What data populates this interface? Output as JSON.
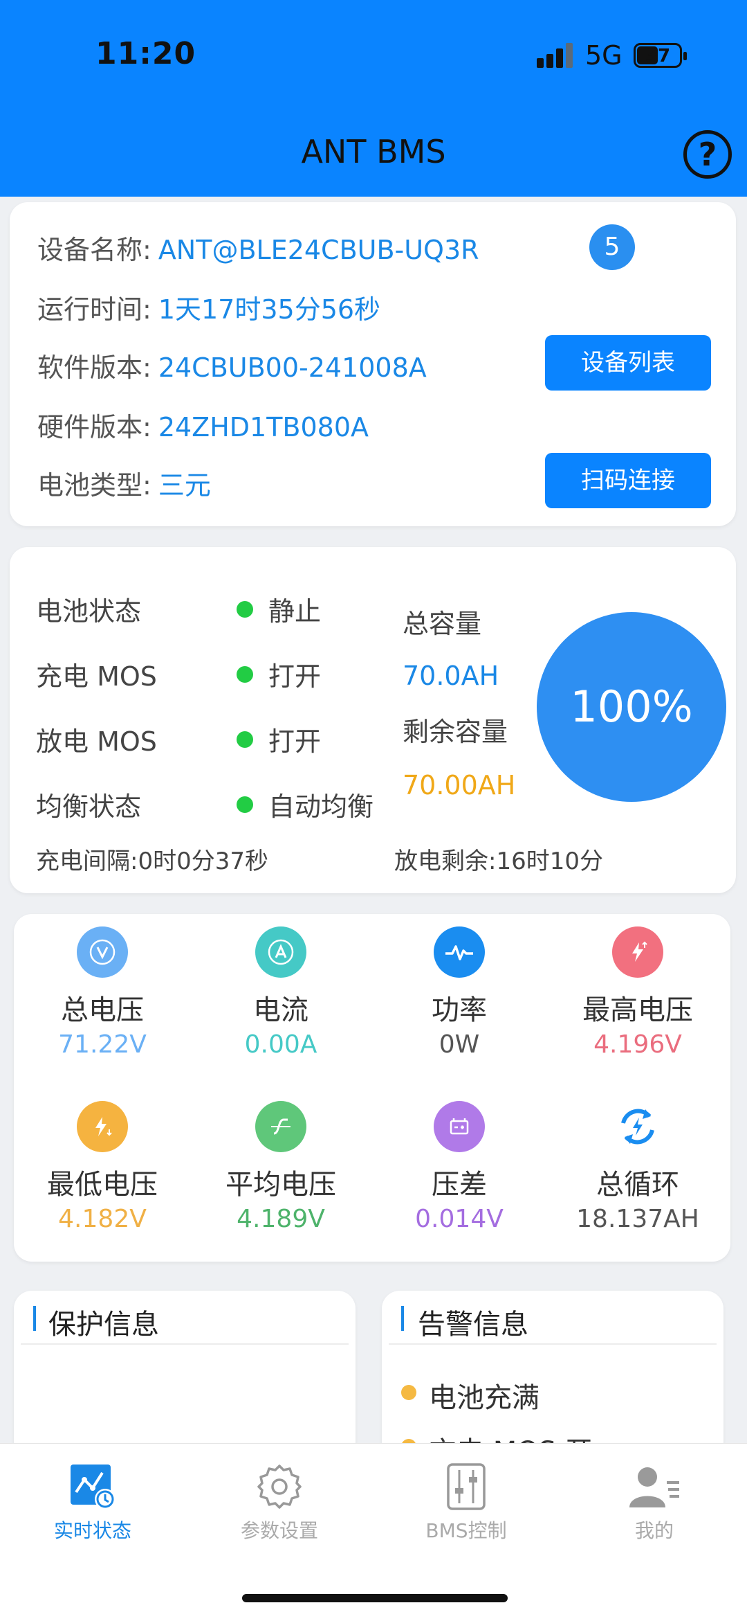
{
  "status_bar": {
    "time": "11:20",
    "network": "5G",
    "battery": "37"
  },
  "header": {
    "title": "ANT BMS",
    "help_icon": "question-circle-icon"
  },
  "device": {
    "rows": [
      {
        "label": "设备名称:",
        "value": "ANT@BLE24CBUB-UQ3R"
      },
      {
        "label": "运行时间:",
        "value": "1天17时35分56秒"
      },
      {
        "label": "软件版本:",
        "value": "24CBUB00-241008A"
      },
      {
        "label": "硬件版本:",
        "value": "24ZHD1TB080A"
      },
      {
        "label": "电池类型:",
        "value": "三元"
      }
    ],
    "badge": "5",
    "device_list_button": "设备列表",
    "scan_connect_button": "扫码连接"
  },
  "battery_status": {
    "rows": [
      {
        "label": "电池状态",
        "value": "静止"
      },
      {
        "label": "充电 MOS",
        "value": "打开"
      },
      {
        "label": "放电 MOS",
        "value": "打开"
      },
      {
        "label": "均衡状态",
        "value": "自动均衡"
      }
    ],
    "total_capacity_label": "总容量",
    "total_capacity_value": "70.0AH",
    "remaining_capacity_label": "剩余容量",
    "remaining_capacity_value": "70.00AH",
    "soc": "100%",
    "charge_interval": "充电间隔:0时0分37秒",
    "discharge_remaining": "放电剩余:16时10分",
    "colors": {
      "dot": "#22cc44",
      "total": "#1a88e6",
      "remaining": "#f0a818",
      "circle": "#2e8ff2"
    }
  },
  "metrics": [
    {
      "name": "总电压",
      "value": "71.22V",
      "icon": "voltage-icon",
      "color": "#6ab0f5",
      "value_color": "#6ab0f5"
    },
    {
      "name": "电流",
      "value": "0.00A",
      "icon": "current-icon",
      "color": "#45c9c6",
      "value_color": "#45c9c6"
    },
    {
      "name": "功率",
      "value": "0W",
      "icon": "power-icon",
      "color": "#1a8df0",
      "value_color": "#555555"
    },
    {
      "name": "最高电压",
      "value": "4.196V",
      "icon": "max-voltage-icon",
      "color": "#f2707f",
      "value_color": "#ea6d7e"
    },
    {
      "name": "最低电压",
      "value": "4.182V",
      "icon": "min-voltage-icon",
      "color": "#f5b340",
      "value_color": "#f0b045"
    },
    {
      "name": "平均电压",
      "value": "4.189V",
      "icon": "avg-voltage-icon",
      "color": "#5fc77a",
      "value_color": "#4eb36b"
    },
    {
      "name": "压差",
      "value": "0.014V",
      "icon": "voltage-diff-icon",
      "color": "#b07ae8",
      "value_color": "#a46de0"
    },
    {
      "name": "总循环",
      "value": "18.137AH",
      "icon": "cycle-icon",
      "color": "#1a8df0",
      "value_color": "#555555"
    }
  ],
  "protect": {
    "title": "保护信息"
  },
  "alarm": {
    "title": "告警信息",
    "items": [
      "电池充满",
      "充电 MOS 开"
    ]
  },
  "tabs": [
    {
      "label": "实时状态",
      "icon": "realtime-status-icon",
      "active": true
    },
    {
      "label": "参数设置",
      "icon": "gear-icon",
      "active": false
    },
    {
      "label": "BMS控制",
      "icon": "sliders-icon",
      "active": false
    },
    {
      "label": "我的",
      "icon": "user-icon",
      "active": false
    }
  ]
}
